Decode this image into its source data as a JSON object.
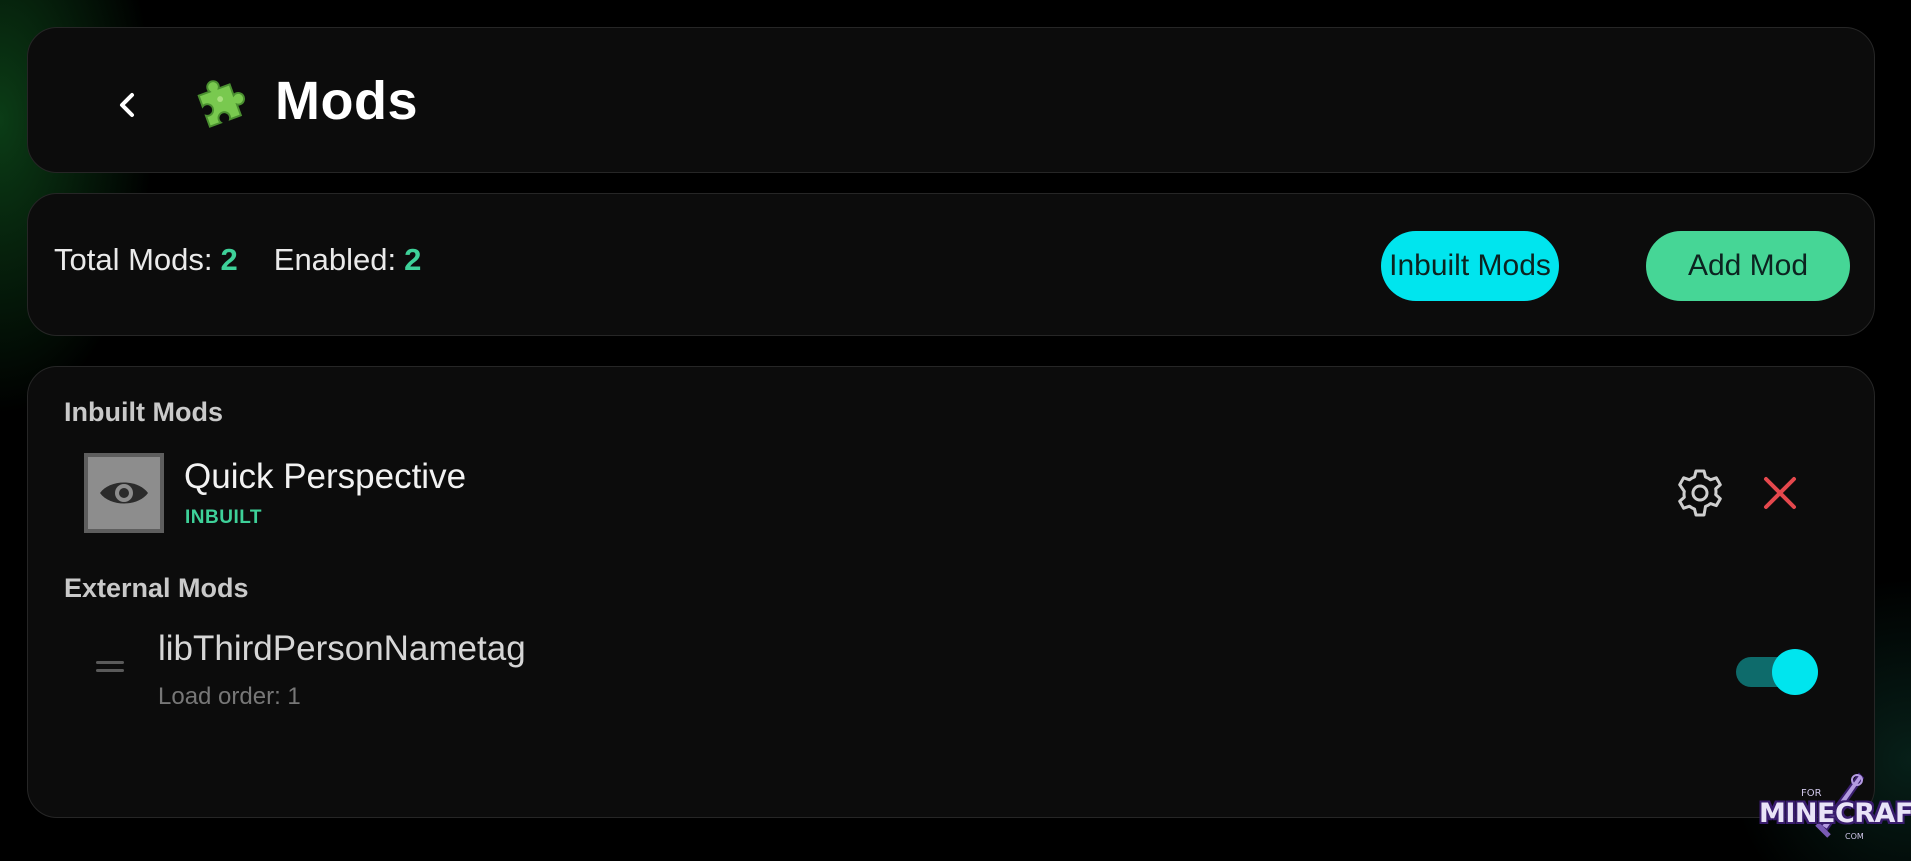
{
  "header": {
    "title": "Mods",
    "back_icon": "chevron-left-icon",
    "title_icon": "puzzle-icon"
  },
  "stats": {
    "total_label": "Total Mods:",
    "total_value": "2",
    "enabled_label": "Enabled:",
    "enabled_value": "2",
    "inbuilt_button": "Inbuilt Mods",
    "add_button": "Add Mod"
  },
  "inbuilt_section": {
    "heading": "Inbuilt Mods",
    "mods": [
      {
        "name": "Quick Perspective",
        "tag": "INBUILT",
        "icon": "eye-icon",
        "actions": [
          "gear-icon",
          "close-icon"
        ]
      }
    ]
  },
  "external_section": {
    "heading": "External Mods",
    "mods": [
      {
        "name": "libThirdPersonNametag",
        "load_order": "Load order: 1",
        "enabled": true
      }
    ]
  },
  "watermark": {
    "top": "FOR",
    "brand": "MINECRAFT",
    "bottom": "COM"
  },
  "colors": {
    "accent_green": "#3ed199",
    "accent_cyan": "#00e5ee",
    "button_green": "#46d696",
    "delete_red": "#e5484d",
    "panel_bg": "#0c0c0c"
  }
}
